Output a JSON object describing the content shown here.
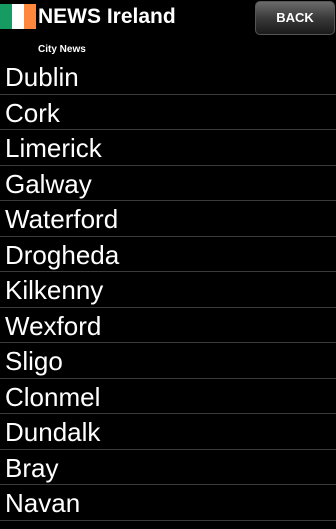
{
  "header": {
    "title": "NEWS Ireland",
    "flag_colors": [
      "#169b62",
      "#ffffff",
      "#ff883e"
    ],
    "back_label": "BACK"
  },
  "section_label": "City News",
  "cities": [
    "Dublin",
    "Cork",
    "Limerick",
    "Galway",
    "Waterford",
    "Drogheda",
    "Kilkenny",
    "Wexford",
    "Sligo",
    "Clonmel",
    "Dundalk",
    "Bray",
    "Navan"
  ]
}
